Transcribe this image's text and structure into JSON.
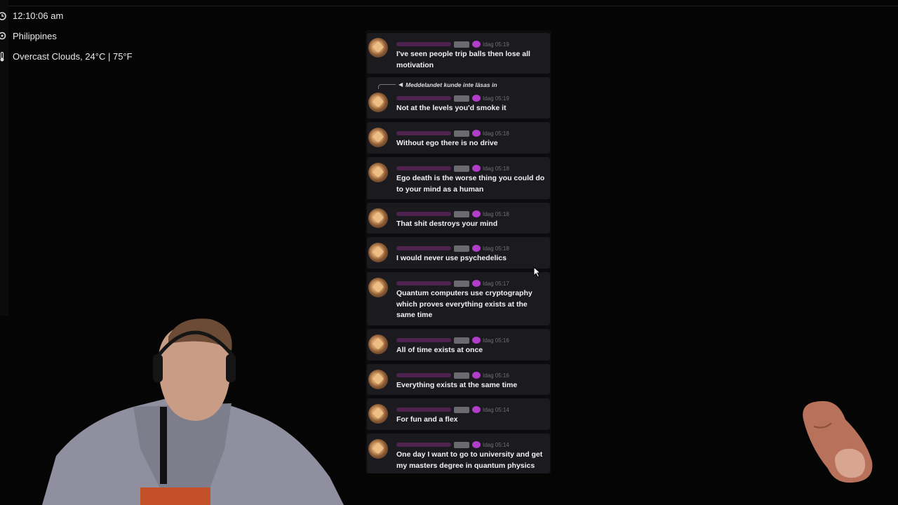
{
  "overlay": {
    "time": "12:10:06 am",
    "location": "Philippines",
    "weather": "Overcast Clouds, 24°C | 75°F",
    "time_icon": "clock-icon",
    "location_icon": "location-pin-icon",
    "weather_icon": "thermometer-icon"
  },
  "chat": {
    "messages": [
      {
        "time": "Idag 05:19",
        "text": "I've seen people trip balls then lose all motivation"
      },
      {
        "time": "Idag 05:19",
        "text": "Not at the levels you'd smoke it",
        "reply": "Meddelandet kunde inte läsas in"
      },
      {
        "time": "Idag 05:18",
        "text": "Without ego there is no drive"
      },
      {
        "time": "Idag 05:18",
        "text": "Ego death is the worse thing you could do to your mind as a human"
      },
      {
        "time": "Idag 05:18",
        "text": "That shit destroys your mind"
      },
      {
        "time": "Idag 05:18",
        "text": "I would never use psychedelics"
      },
      {
        "time": "Idag 05:17",
        "text": "Quantum computers use cryptography which proves everything exists at the same time"
      },
      {
        "time": "Idag 05:16",
        "text": "All of time exists at once"
      },
      {
        "time": "Idag 05:16",
        "text": "Everything exists at the same time"
      },
      {
        "time": "Idag 05:14",
        "text": "For fun and a flex"
      },
      {
        "time": "Idag 05:14",
        "text": "One day I want to go to university and get my masters degree in quantum physics"
      }
    ]
  },
  "colors": {
    "background": "#050505",
    "message_bg": "#1b1b1f",
    "role_badge": "#b13ec9"
  }
}
